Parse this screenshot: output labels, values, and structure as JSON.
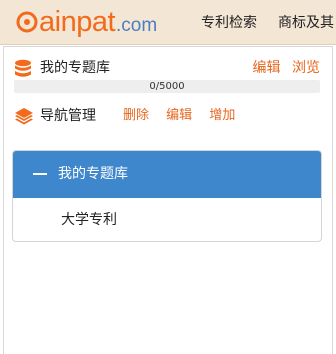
{
  "header": {
    "logo_main": "ainpat",
    "logo_suffix": ".com",
    "nav": [
      "专利检索",
      "商标及其"
    ]
  },
  "library": {
    "title": "我的专题库",
    "edit_label": "编辑",
    "browse_label": "浏览",
    "usage_text": "0/5000",
    "usage_fraction": 0
  },
  "nav_manage": {
    "title": "导航管理",
    "delete_label": "删除",
    "edit_label": "编辑",
    "add_label": "增加"
  },
  "tree": {
    "root_label": "我的专题库",
    "items": [
      "大学专利"
    ]
  },
  "colors": {
    "accent": "#f26b1d",
    "header_bg": "#f4e6d4",
    "tree_head": "#3f87cc"
  }
}
